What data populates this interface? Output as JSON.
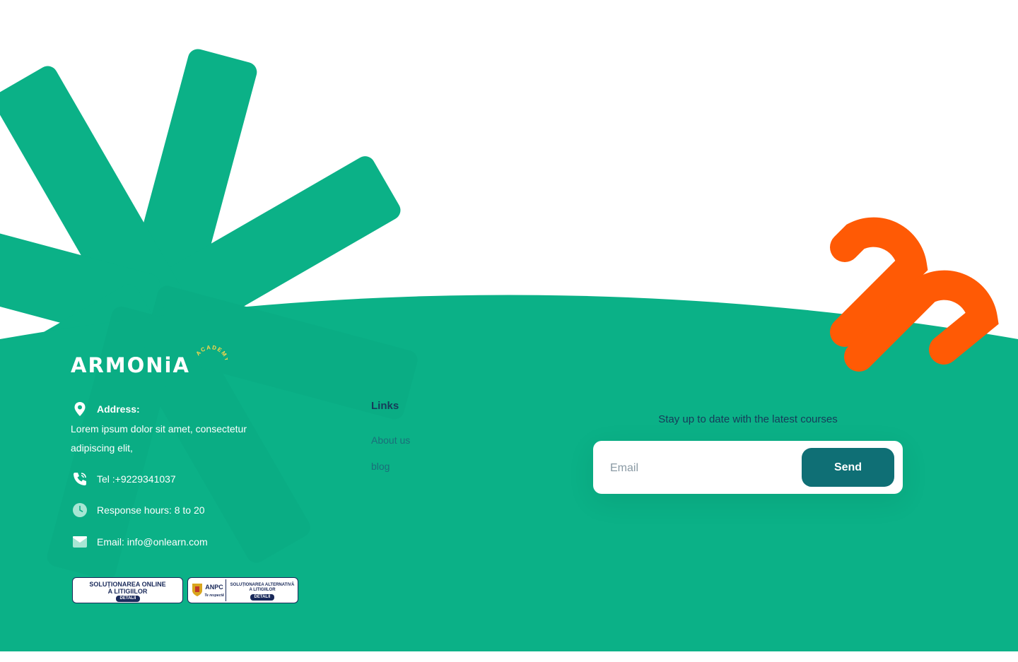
{
  "colors": {
    "footer_green": "#0bb187",
    "accent_orange": "#ff5a05",
    "button_teal": "#0f6f75",
    "dark_text": "#173b5a",
    "link_color": "#1b6e7a"
  },
  "brand": {
    "name": "ARMONiA",
    "sub": "ACADEMY",
    "tm": "™"
  },
  "contact": {
    "address_label": "Address:",
    "address_text": "Lorem ipsum dolor sit amet, consectetur adipiscing elit,",
    "phone": "Tel :+9229341037",
    "hours": "Response hours: 8 to 20",
    "email": "Email: info@onlearn.com",
    "icons": [
      "location-pin-icon",
      "phone-icon",
      "clock-icon",
      "mail-icon"
    ]
  },
  "links": {
    "title": "Links",
    "items": [
      "About us",
      "blog"
    ]
  },
  "newsletter": {
    "title": "Stay up to date with the latest courses",
    "placeholder": "Email",
    "button": "Send"
  },
  "badges": {
    "sol": {
      "line1": "SOLUȚIONAREA ONLINE",
      "line2": "A LITIGIILOR",
      "btn": "DETALII"
    },
    "sal": {
      "anpc": "ANPC",
      "line1": "SOLUȚIONAREA ALTERNATIVĂ",
      "line2": "A LITIGIILOR",
      "btn": "DETALII",
      "tag": "Te respectă"
    }
  }
}
